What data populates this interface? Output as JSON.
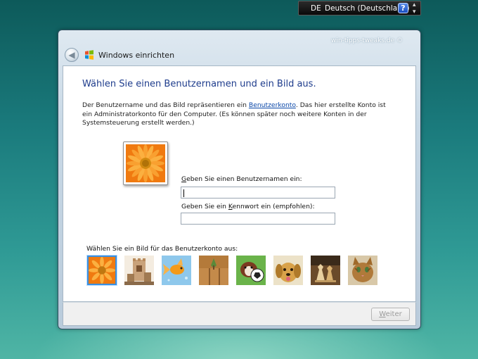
{
  "language_bar": {
    "code": "DE",
    "name": "Deutsch (Deutschland)",
    "help_label": "?"
  },
  "window": {
    "watermark": "win-tipps-tweaks.de ©",
    "title": "Windows einrichten"
  },
  "page": {
    "heading": "Wählen Sie einen Benutzernamen und ein Bild aus.",
    "desc_before_link": "Der Benutzername und das Bild repräsentieren ein ",
    "desc_link": "Benutzerkonto",
    "desc_after_link": ". Das hier erstellte Konto ist ein Administratorkonto für den Computer. (Es können später noch weitere Konten in der Systemsteuerung erstellt werden.)",
    "username_label": "Geben Sie einen Benutzernamen ein:",
    "username_value": "",
    "password_label_before": "Geben Sie ein ",
    "password_label_accel": "K",
    "password_label_after": "ennwort ein (empfohlen):",
    "password_value": "",
    "picture_label": "Wählen Sie ein Bild für das Benutzerkonto aus:"
  },
  "pictures": [
    "flower",
    "chess-castle",
    "goldfish",
    "wooden-panel",
    "dog-with-ball",
    "puppy",
    "chess-pieces",
    "kitten"
  ],
  "selected_picture": 0,
  "footer": {
    "next_button": "Weiter"
  },
  "colors": {
    "heading": "#1e3c8c",
    "link": "#0a47a8",
    "selection": "#3a8fe0"
  }
}
